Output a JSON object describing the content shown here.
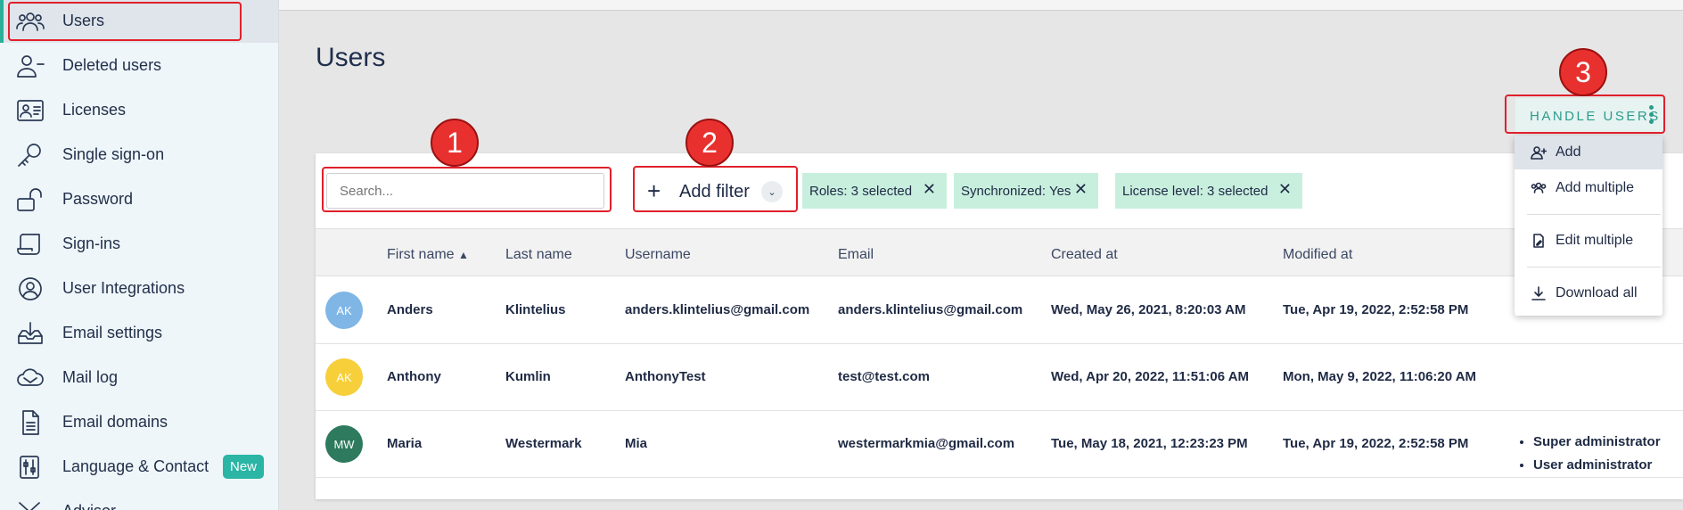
{
  "sidebar": {
    "items": [
      {
        "label": "Users",
        "icon": "users-icon",
        "active": true
      },
      {
        "label": "Deleted users",
        "icon": "user-minus-icon"
      },
      {
        "label": "Licenses",
        "icon": "id-card-icon"
      },
      {
        "label": "Single sign-on",
        "icon": "key-icon"
      },
      {
        "label": "Password",
        "icon": "unlock-icon"
      },
      {
        "label": "Sign-ins",
        "icon": "scroll-icon"
      },
      {
        "label": "User Integrations",
        "icon": "user-circle-icon"
      },
      {
        "label": "Email settings",
        "icon": "inbox-download-icon"
      },
      {
        "label": "Mail log",
        "icon": "mail-cloud-icon"
      },
      {
        "label": "Email domains",
        "icon": "document-icon"
      },
      {
        "label": "Language & Contact",
        "icon": "settings-sliders-icon",
        "badge": "New"
      },
      {
        "label": "Advisor",
        "icon": "advisor-icon"
      }
    ]
  },
  "page": {
    "title": "Users"
  },
  "handle_users": {
    "label": "HANDLE USERS"
  },
  "menu": {
    "items": [
      {
        "label": "Add",
        "icon": "user-add-icon"
      },
      {
        "label": "Add multiple",
        "icon": "users-add-icon"
      },
      {
        "label": "Edit multiple",
        "icon": "edit-document-icon"
      },
      {
        "label": "Download all",
        "icon": "download-icon"
      }
    ]
  },
  "toolbar": {
    "search_placeholder": "Search...",
    "add_filter_label": "Add filter",
    "chips": [
      {
        "label": "Roles: 3 selected"
      },
      {
        "label": "Synchronized: Yes"
      },
      {
        "label": "License level: 3 selected"
      }
    ]
  },
  "table": {
    "columns": [
      "First name",
      "Last name",
      "Username",
      "Email",
      "Created at",
      "Modified at"
    ],
    "rows": [
      {
        "initials": "AK",
        "avatar_color": "#7fb6e6",
        "first": "Anders",
        "last": "Klintelius",
        "username": "anders.klintelius@gmail.com",
        "email": "anders.klintelius@gmail.com",
        "created": "Wed, May 26, 2021, 8:20:03 AM",
        "modified": "Tue, Apr 19, 2022, 2:52:58 PM",
        "roles": []
      },
      {
        "initials": "AK",
        "avatar_color": "#f7cf3a",
        "first": "Anthony",
        "last": "Kumlin",
        "username": "AnthonyTest",
        "email": "test@test.com",
        "created": "Wed, Apr 20, 2022, 11:51:06 AM",
        "modified": "Mon, May 9, 2022, 11:06:20 AM",
        "roles": []
      },
      {
        "initials": "MW",
        "avatar_color": "#2d7a5e",
        "first": "Maria",
        "last": "Westermark",
        "username": "Mia",
        "email": "westermarkmia@gmail.com",
        "created": "Tue, May 18, 2021, 12:23:23 PM",
        "modified": "Tue, Apr 19, 2022, 2:52:58 PM",
        "roles": [
          "Super administrator",
          "User administrator"
        ]
      }
    ]
  },
  "annotations": {
    "markers": [
      "1",
      "2",
      "3"
    ]
  },
  "colors": {
    "accent": "#2ab09a",
    "chip_bg": "#c8efde",
    "annotation_red": "#e8312f"
  }
}
